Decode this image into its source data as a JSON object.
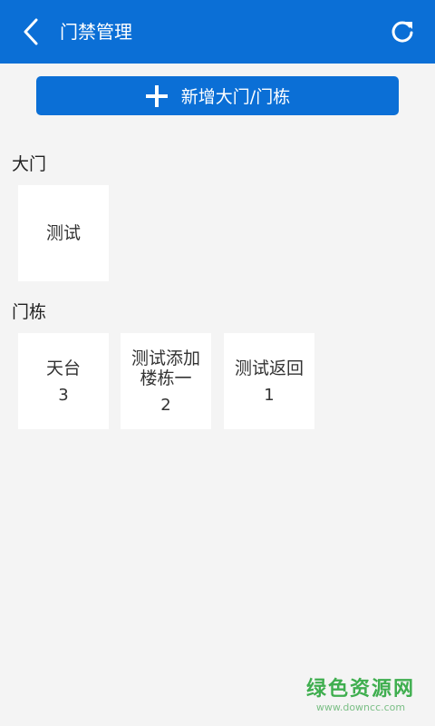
{
  "header": {
    "title": "门禁管理",
    "back_icon": "chevron-left-icon",
    "refresh_icon": "refresh-icon",
    "color": "#0b6fd6"
  },
  "add_button": {
    "label": "新增大门/门栋",
    "icon": "plus-icon"
  },
  "gates": {
    "title": "大门",
    "items": [
      {
        "name": "测试"
      }
    ]
  },
  "buildings": {
    "title": "门栋",
    "items": [
      {
        "name": "天台",
        "count": "3"
      },
      {
        "name": "测试添加楼栋一",
        "count": "2"
      },
      {
        "name": "测试返回",
        "count": "1"
      }
    ]
  },
  "watermark": {
    "text": "绿色资源网",
    "url": "www.downcc.com"
  }
}
